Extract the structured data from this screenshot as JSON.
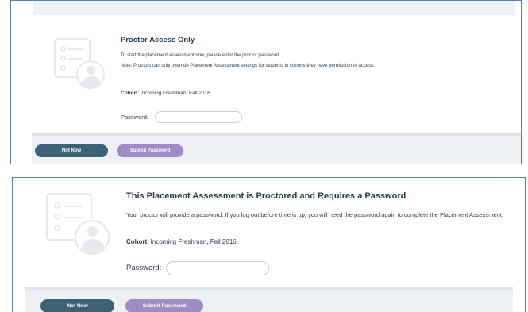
{
  "panel_top": {
    "title": "Proctor Access Only",
    "line1": "To start the placement assessment now, please enter the proctor password.",
    "line2": "Note: Proctors can only override Placement Assessment settings for students in cohorts they have permission to access.",
    "cohort_label": "Cohort",
    "cohort_value": ": Incoming Freshman, Fall 2016",
    "password_label": "Password:",
    "not_now_label": "Not Now",
    "submit_label": "Submit Password"
  },
  "panel_bottom": {
    "title": "This Placement Assessment is Proctored and Requires a Password",
    "body": "Your proctor will provide a password. If you log out before time is up, you will need the password again to complete the Placement Assessment.",
    "cohort_label": "Cohort",
    "cohort_value": ": Incoming Freshman, Fall 2016",
    "password_label": "Password:",
    "not_now_label": "Not Now",
    "submit_label": "Submit Password"
  },
  "colors": {
    "border": "#5a7fa3",
    "dark_button": "#3d6275",
    "purple_button": "#a08cc4",
    "footer_bg": "#eef1f3"
  }
}
